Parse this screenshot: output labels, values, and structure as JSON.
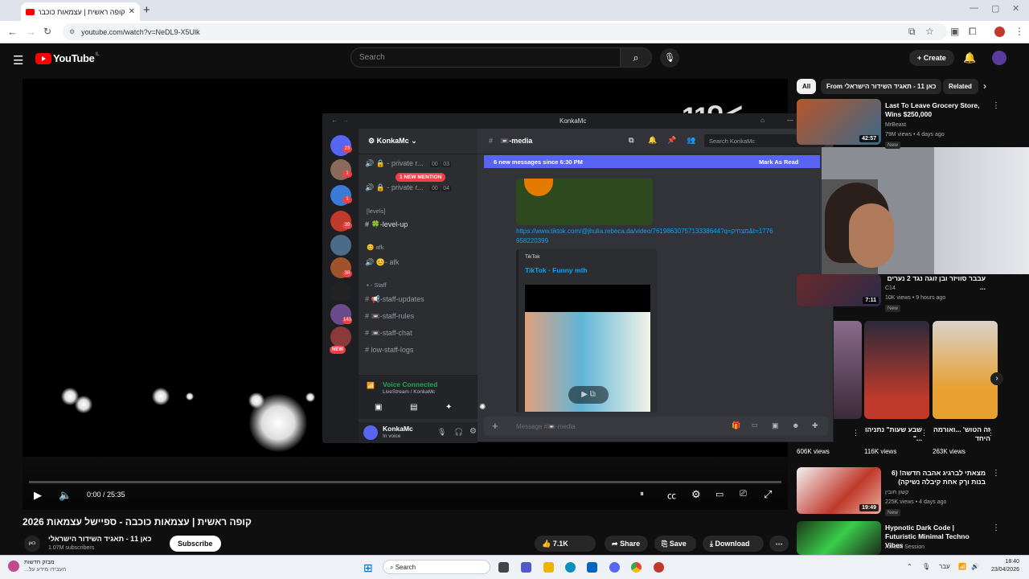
{
  "browser": {
    "tab_title": "קופה ראשית | עצמאות כוכבה - ספיישל עצמאות 2026",
    "url": "youtube.com/watch?v=NeDL9-X5Ulk"
  },
  "youtube": {
    "logo_text": "YouTube",
    "region": "IL",
    "search_placeholder": "Search",
    "create_label": "Create"
  },
  "player": {
    "time": "0:00 / 25:35",
    "progress_fraction": 0.0
  },
  "video": {
    "title": "קופה ראשית | עצמאות כוכבה - ספיישל עצמאות 2026",
    "channel_avatar_text": "כאן",
    "channel": "כאן 11 - תאגיד השידור הישראלי",
    "subscribers": "1.07M subscribers",
    "subscribe_label": "Subscribe",
    "likes": "7.1K",
    "share_label": "Share",
    "save_label": "Save",
    "download_label": "Download"
  },
  "discord": {
    "window_title": "KonkaMc",
    "server_name": "KonkaMc",
    "new_mention": "1 NEW MENTION",
    "channels": [
      {
        "name": "- private r...",
        "a": "00",
        "b": "03"
      },
      {
        "name": "- private r...",
        "a": "00",
        "b": "04"
      }
    ],
    "categories": {
      "levels": "[levels]",
      "afk": "afk",
      "staff": "Staff"
    },
    "level_channel": "-level-up",
    "afk_channel": "- afk",
    "staff_channels": [
      "-staff-updates",
      "-staff-rules",
      "-staff-chat",
      "low-staff-logs"
    ],
    "guild_badges": [
      "23",
      "1",
      "1",
      "39",
      "38",
      "143"
    ],
    "guild_new": "NEW",
    "voice_status": "Voice Connected",
    "voice_channel": "LiveStream / KonkaMc",
    "user_name": "KonkaMc",
    "user_status": "In voice",
    "current_channel": "-media",
    "search_placeholder": "Search KonkaMc",
    "new_messages": "6 new messages since 6:30 PM",
    "mark_read": "Mark As Read",
    "link": "https://www.tiktok.com/@jhulia.rebeca.da/video/7619863075713338644?q=מצחיק&t=1776958220399",
    "embed_provider": "TikTok",
    "embed_title": "TikTok · Funny mth",
    "composer_placeholder": "Message #📼-media"
  },
  "sidebar": {
    "chips": [
      "All",
      "From כאן 11 - תאגיד השידור הישראלי",
      "Related"
    ],
    "videos": [
      {
        "title": "Last To Leave Grocery Store, Wins $250,000",
        "channel": "MrBeast",
        "meta": "79M views • 4 days ago",
        "badge": "New",
        "duration": "42:57"
      },
      {
        "title": "עבבר סוויזר ובן זוגה נגד 2 נערים ...",
        "channel": "C14",
        "meta": "10K views • 9 hours ago",
        "badge": "New",
        "duration": "7:11"
      },
      {
        "title": "מצאתי לברגיג אהבה חדשה! (6 בנות וךק אחת קיבלה נשיקה)",
        "channel": "קשון חובין",
        "meta": "225K views • 4 days ago",
        "badge": "New",
        "duration": "19:49"
      },
      {
        "title": "Hypnotic Dark Code | Futuristic Minimal Techno Vibes",
        "channel": "Amoda Session",
        "meta": "",
        "badge": "",
        "duration": ""
      }
    ],
    "shorts": [
      {
        "title": "שבע שעות\" נתניהו ...\"",
        "views": "116K views"
      },
      {
        "title": "זה הטוש' ...ואורמה היחד",
        "views": "263K views"
      }
    ],
    "shorts_left_views": "606K views"
  },
  "taskbar": {
    "weather": "מבזק חדשות",
    "weather_sub": "העבירו מידע על...",
    "search": "Search",
    "lang": "עבר",
    "clock": "18:40",
    "date": "23/04/2026"
  }
}
